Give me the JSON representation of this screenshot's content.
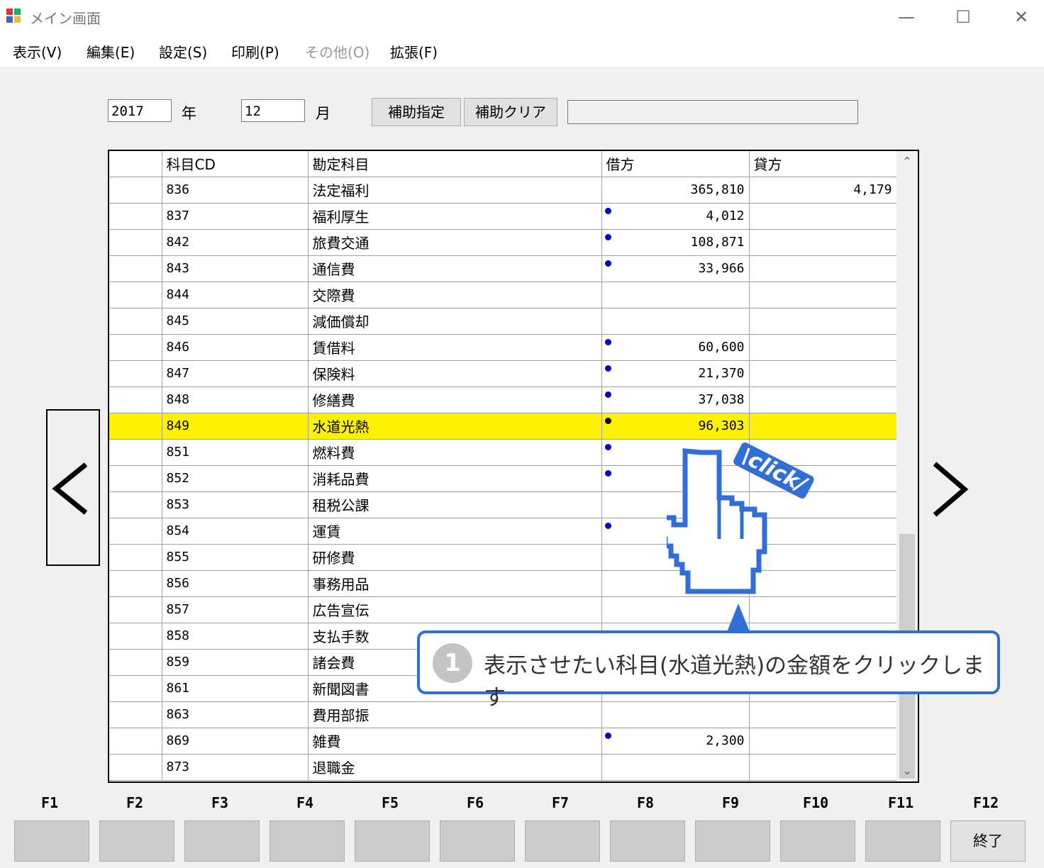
{
  "window": {
    "title": "メイン画面",
    "minimize": "—",
    "maximize": "☐",
    "close": "✕"
  },
  "menu": [
    "表示(V)",
    "編集(E)",
    "設定(S)",
    "印刷(P)",
    "その他(O)",
    "拡張(F)"
  ],
  "menu_disabled_index": 4,
  "filter": {
    "year_value": "2017",
    "year_label": "年",
    "month_value": "12",
    "month_label": "月",
    "btn_sub": "補助指定",
    "btn_clear": "補助クリア"
  },
  "grid": {
    "headers": [
      "",
      "科目CD",
      "勘定科目",
      "借方",
      "貸方"
    ],
    "rows": [
      {
        "cd": "836",
        "name": "法定福利",
        "debit": "365,810",
        "credit": "4,179",
        "dot": ""
      },
      {
        "cd": "837",
        "name": "福利厚生",
        "debit": "4,012",
        "credit": "",
        "dot": "blue"
      },
      {
        "cd": "842",
        "name": "旅費交通",
        "debit": "108,871",
        "credit": "",
        "dot": "blue"
      },
      {
        "cd": "843",
        "name": "通信費",
        "debit": "33,966",
        "credit": "",
        "dot": "blue"
      },
      {
        "cd": "844",
        "name": "交際費",
        "debit": "",
        "credit": "",
        "dot": ""
      },
      {
        "cd": "845",
        "name": "減価償却",
        "debit": "",
        "credit": "",
        "dot": ""
      },
      {
        "cd": "846",
        "name": "賃借料",
        "debit": "60,600",
        "credit": "",
        "dot": "blue"
      },
      {
        "cd": "847",
        "name": "保険料",
        "debit": "21,370",
        "credit": "",
        "dot": "blue"
      },
      {
        "cd": "848",
        "name": "修繕費",
        "debit": "37,038",
        "credit": "",
        "dot": "blue"
      },
      {
        "cd": "849",
        "name": "水道光熱",
        "debit": "96,303",
        "credit": "",
        "dot": "black",
        "highlight": true
      },
      {
        "cd": "851",
        "name": "燃料費",
        "debit": "",
        "credit": "",
        "dot": "blue"
      },
      {
        "cd": "852",
        "name": "消耗品費",
        "debit": "",
        "credit": "",
        "dot": "blue"
      },
      {
        "cd": "853",
        "name": "租税公課",
        "debit": "",
        "credit": "",
        "dot": ""
      },
      {
        "cd": "854",
        "name": "運賃",
        "debit": "",
        "credit": "",
        "dot": "blue"
      },
      {
        "cd": "855",
        "name": "研修費",
        "debit": "",
        "credit": "",
        "dot": ""
      },
      {
        "cd": "856",
        "name": "事務用品",
        "debit": "",
        "credit": "",
        "dot": ""
      },
      {
        "cd": "857",
        "name": "広告宣伝",
        "debit": "",
        "credit": "",
        "dot": ""
      },
      {
        "cd": "858",
        "name": "支払手数",
        "debit": "",
        "credit": "",
        "dot": ""
      },
      {
        "cd": "859",
        "name": "諸会費",
        "debit": "",
        "credit": "",
        "dot": ""
      },
      {
        "cd": "861",
        "name": "新聞図書",
        "debit": "",
        "credit": "",
        "dot": ""
      },
      {
        "cd": "863",
        "name": "費用部振",
        "debit": "",
        "credit": "",
        "dot": ""
      },
      {
        "cd": "869",
        "name": "雑費",
        "debit": "2,300",
        "credit": "",
        "dot": "blue"
      },
      {
        "cd": "873",
        "name": "退職金",
        "debit": "",
        "credit": "",
        "dot": ""
      }
    ]
  },
  "nav": {
    "prev": "‹",
    "next": "›"
  },
  "fkeys": [
    "F1",
    "F2",
    "F3",
    "F4",
    "F5",
    "F6",
    "F7",
    "F8",
    "F9",
    "F10",
    "F11",
    "F12"
  ],
  "f12_label": "終了",
  "callout": {
    "number": "1",
    "text": "表示させたい科目(水道光熱)の金額をクリックします",
    "click": "\\click/"
  },
  "colors": {
    "highlight": "#fff200",
    "callout_border": "#2f6fd6",
    "dot": "#0000cc"
  }
}
